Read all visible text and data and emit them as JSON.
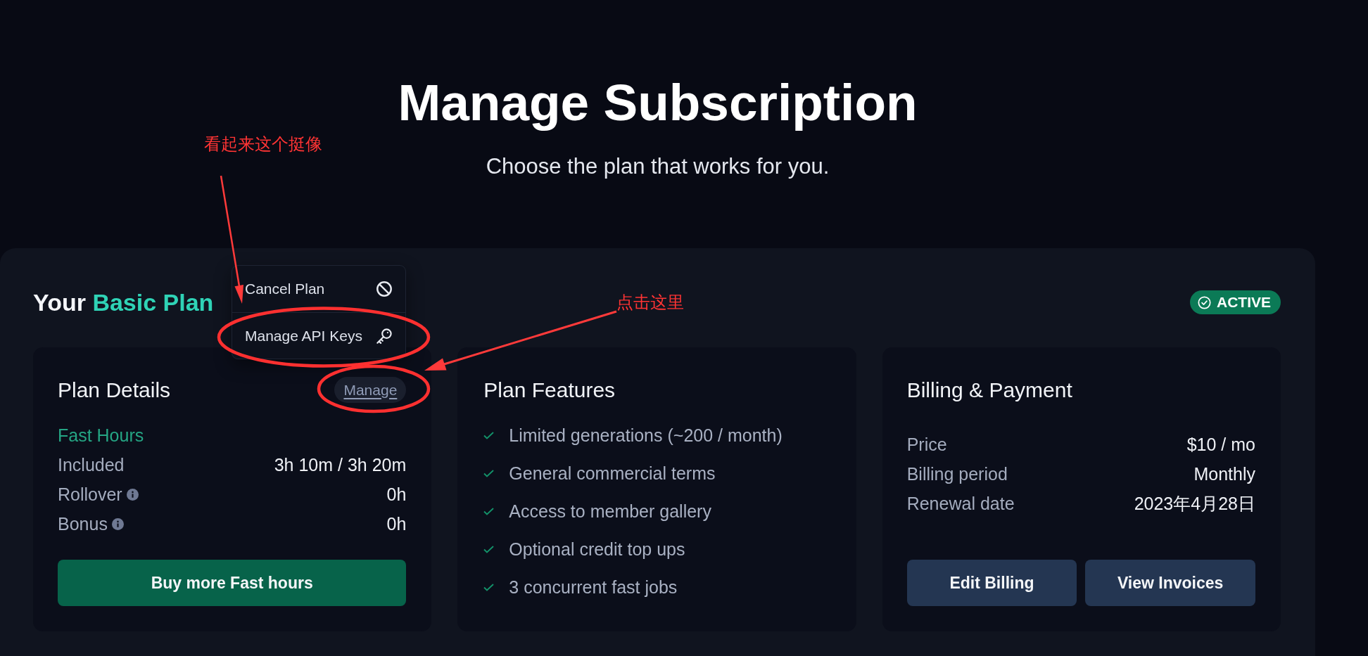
{
  "header": {
    "title": "Manage Subscription",
    "subtitle": "Choose the plan that works for you."
  },
  "plan": {
    "heading_prefix": "Your",
    "name": "Basic Plan",
    "status": "ACTIVE",
    "menu": [
      {
        "kind": "cancel",
        "label": "Cancel Plan"
      },
      {
        "kind": "key",
        "label": "Manage API Keys"
      }
    ]
  },
  "plan_details": {
    "title": "Plan Details",
    "link": "Manage",
    "section": "Fast Hours",
    "rows": [
      {
        "label": "Included",
        "value": "3h 10m / 3h 20m",
        "info": false
      },
      {
        "label": "Rollover",
        "value": "0h",
        "info": true
      },
      {
        "label": "Bonus",
        "value": "0h",
        "info": true
      }
    ],
    "button": "Buy more Fast hours"
  },
  "plan_features": {
    "title": "Plan Features",
    "items": [
      "Limited generations (~200 / month)",
      "General commercial terms",
      "Access to member gallery",
      "Optional credit top ups",
      "3 concurrent fast jobs"
    ]
  },
  "billing": {
    "title": "Billing & Payment",
    "rows": [
      {
        "label": "Price",
        "value": "$10 / mo"
      },
      {
        "label": "Billing period",
        "value": "Monthly"
      },
      {
        "label": "Renewal date",
        "value": "2023年4月28日"
      }
    ],
    "buttons": [
      "Edit Billing",
      "View Invoices"
    ]
  },
  "annotations": [
    {
      "text": "看起来这个挺像"
    },
    {
      "text": "点击这里"
    }
  ]
}
